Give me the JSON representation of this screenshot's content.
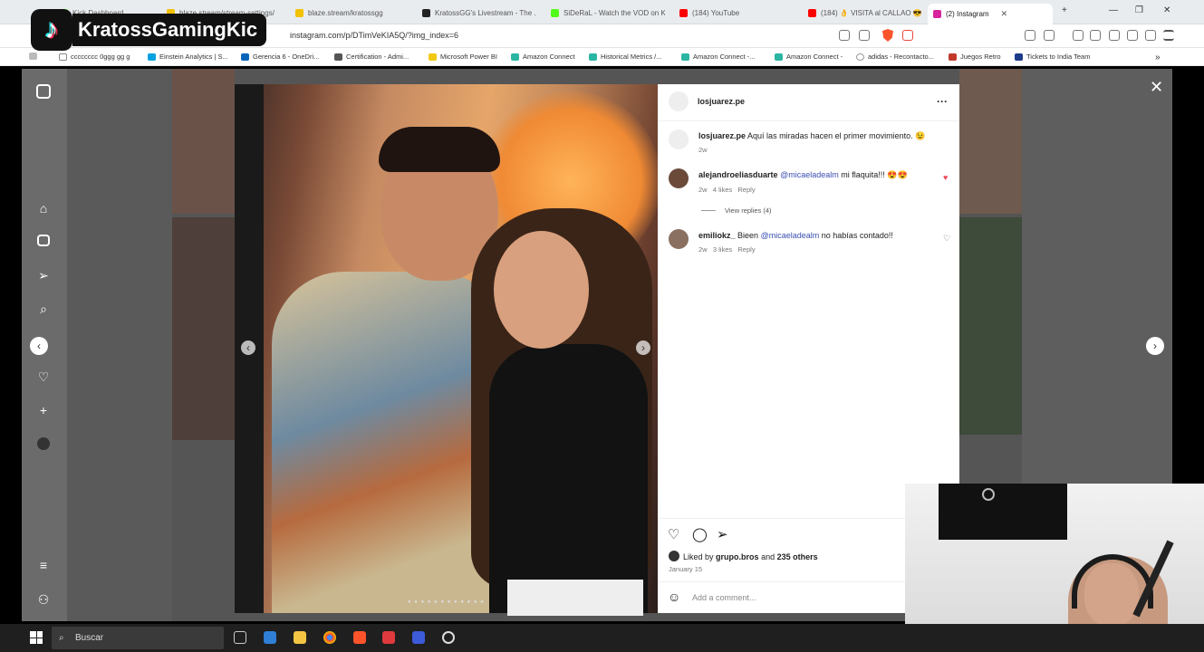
{
  "browser": {
    "tabs": [
      {
        "title": "Kick Dashboard",
        "color": "#53fc18"
      },
      {
        "title": "blaze.stream/stream-settings/",
        "color": "#f2c200"
      },
      {
        "title": "blaze.stream/kratossgg",
        "color": "#f2c200"
      },
      {
        "title": "KratossGG's Livestream - The ...",
        "color": "#222222"
      },
      {
        "title": "SiDeRaL - Watch the VOD on K...",
        "color": "#53fc18"
      },
      {
        "title": "(184) YouTube",
        "color": "#ff0000"
      },
      {
        "title": "(184) 👌 VISITA al CALLAO 😎",
        "color": "#ff0000"
      },
      {
        "title": "(2) Instagram",
        "color": "#d6249f"
      }
    ],
    "url": "instagram.com/p/DTimVeKIA5Q/?img_index=6",
    "bookmarks": [
      {
        "label": "cccccccc 0ggg gg g",
        "color": "#888888"
      },
      {
        "label": "Einstein Analytics | S...",
        "color": "#00a1e0"
      },
      {
        "label": "Gerencia 6 - OneDri...",
        "color": "#0364b8"
      },
      {
        "label": "Certification - Admi...",
        "color": "#555555"
      },
      {
        "label": "Microsoft Power BI",
        "color": "#f2c811"
      },
      {
        "label": "Amazon Connect",
        "color": "#2bb5a3"
      },
      {
        "label": "Historical Metrics /...",
        "color": "#2bb5a3"
      },
      {
        "label": "Amazon Connect -...",
        "color": "#2bb5a3"
      },
      {
        "label": "Amazon Connect -",
        "color": "#2bb5a3"
      },
      {
        "label": "adidas - Recontacto...",
        "color": "#999999"
      },
      {
        "label": "Juegos Retro",
        "color": "#c0392b"
      },
      {
        "label": "Tickets to India Team",
        "color": "#1e3a8a"
      }
    ],
    "more_bookmarks": "»"
  },
  "overlay": {
    "channel": "KratossGamingKic",
    "logo": "♪"
  },
  "post": {
    "author": "losjuarez.pe",
    "more": "···",
    "caption_user": "losjuarez.pe",
    "caption_text": "Aquí las miradas hacen el primer movimiento. 😉",
    "caption_time": "2w",
    "comments": [
      {
        "user": "alejandroeliasduarte",
        "mention": "@micaeladealm",
        "text": "mi flaquita!!! 😍😍",
        "time": "2w",
        "likes": "4 likes",
        "reply": "Reply",
        "liked": true,
        "view_replies": "View replies (4)"
      },
      {
        "user": "emiliokz_",
        "pre": "Bieen",
        "mention": "@micaeladealm",
        "text": "no habías contado!!",
        "time": "2w",
        "likes": "3 likes",
        "reply": "Reply",
        "liked": false
      }
    ],
    "liked_by_prefix": "Liked by",
    "liked_by_user": "grupo.bros",
    "liked_by_suffix": "and",
    "liked_by_others": "235 others",
    "date": "January 15",
    "comment_placeholder": "Add a comment..."
  },
  "icons": {
    "close": "✕",
    "prev": "‹",
    "next": "›",
    "heart": "♡",
    "comment": "◯",
    "share": "➢",
    "emoji": "☺",
    "liked_heart": "♥",
    "unliked_heart": "♡"
  },
  "taskbar": {
    "search_placeholder": "Buscar",
    "search_icon": "⌕"
  }
}
